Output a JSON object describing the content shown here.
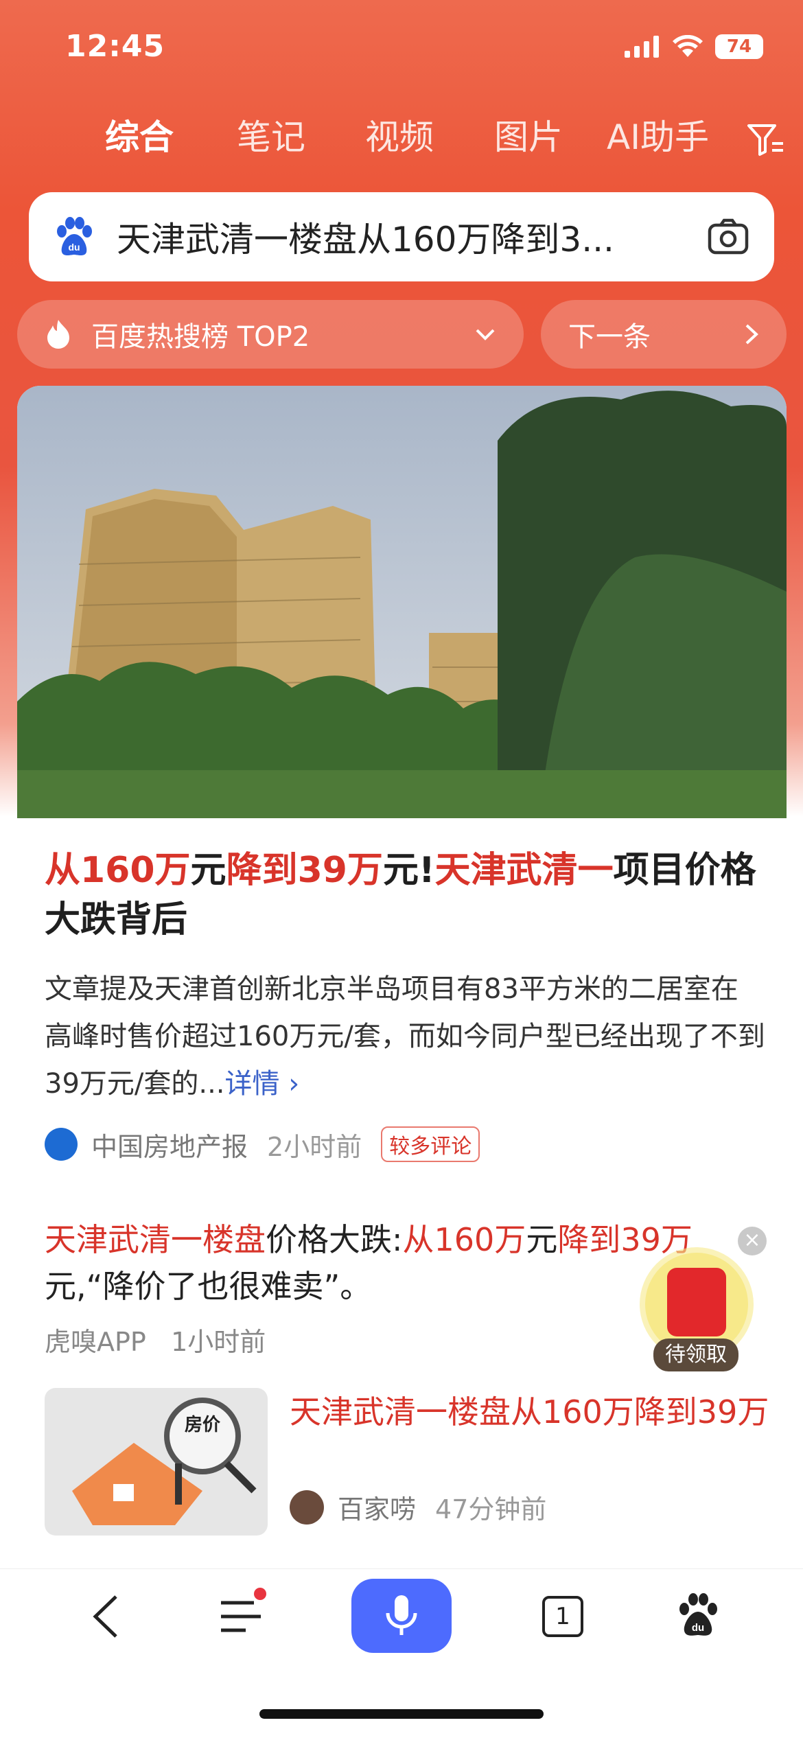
{
  "status": {
    "time": "12:45",
    "battery": "74"
  },
  "tabs": [
    {
      "label": "综合"
    },
    {
      "label": "笔记"
    },
    {
      "label": "视频"
    },
    {
      "label": "图片"
    },
    {
      "label": "AI助手"
    }
  ],
  "search": {
    "query": "天津武清一楼盘从160万降到3..."
  },
  "hot": {
    "label": "百度热搜榜 TOP2",
    "next": "下一条"
  },
  "article": {
    "headline_parts": [
      {
        "text": "从160万",
        "red": true
      },
      {
        "text": "元",
        "red": false
      },
      {
        "text": "降到39万",
        "red": true
      },
      {
        "text": "元!",
        "red": false
      },
      {
        "text": "天津武清一",
        "red": true
      },
      {
        "text": "项目价格大跌背后",
        "red": false
      }
    ],
    "summary": "文章提及天津首创新北京半岛项目有83平方米的二居室在高峰时售价超过160万元/套，而如今同户型已经出现了不到39万元/套的...",
    "more": "详情",
    "source": "中国房地产报",
    "time": "2小时前",
    "badge": "较多评论"
  },
  "item2": {
    "parts": [
      {
        "text": "天津武清一楼盘",
        "red": true
      },
      {
        "text": "价格大跌:",
        "red": false
      },
      {
        "text": "从160万",
        "red": true
      },
      {
        "text": "元",
        "red": false
      },
      {
        "text": "降到39万",
        "red": true
      },
      {
        "text": "元,“降价了也很难卖”。",
        "red": false
      }
    ],
    "source": "虎嗅APP",
    "time": "1小时前"
  },
  "item3": {
    "title": "天津武清一楼盘从160万降到39万",
    "thumb_text": "房价",
    "source": "百家唠",
    "time": "47分钟前"
  },
  "float": {
    "label": "待领取"
  },
  "bottom": {
    "tab_count": "1"
  },
  "colors": {
    "accent": "#ec5538",
    "red_text": "#d8342a",
    "mic": "#4d6bfe"
  }
}
